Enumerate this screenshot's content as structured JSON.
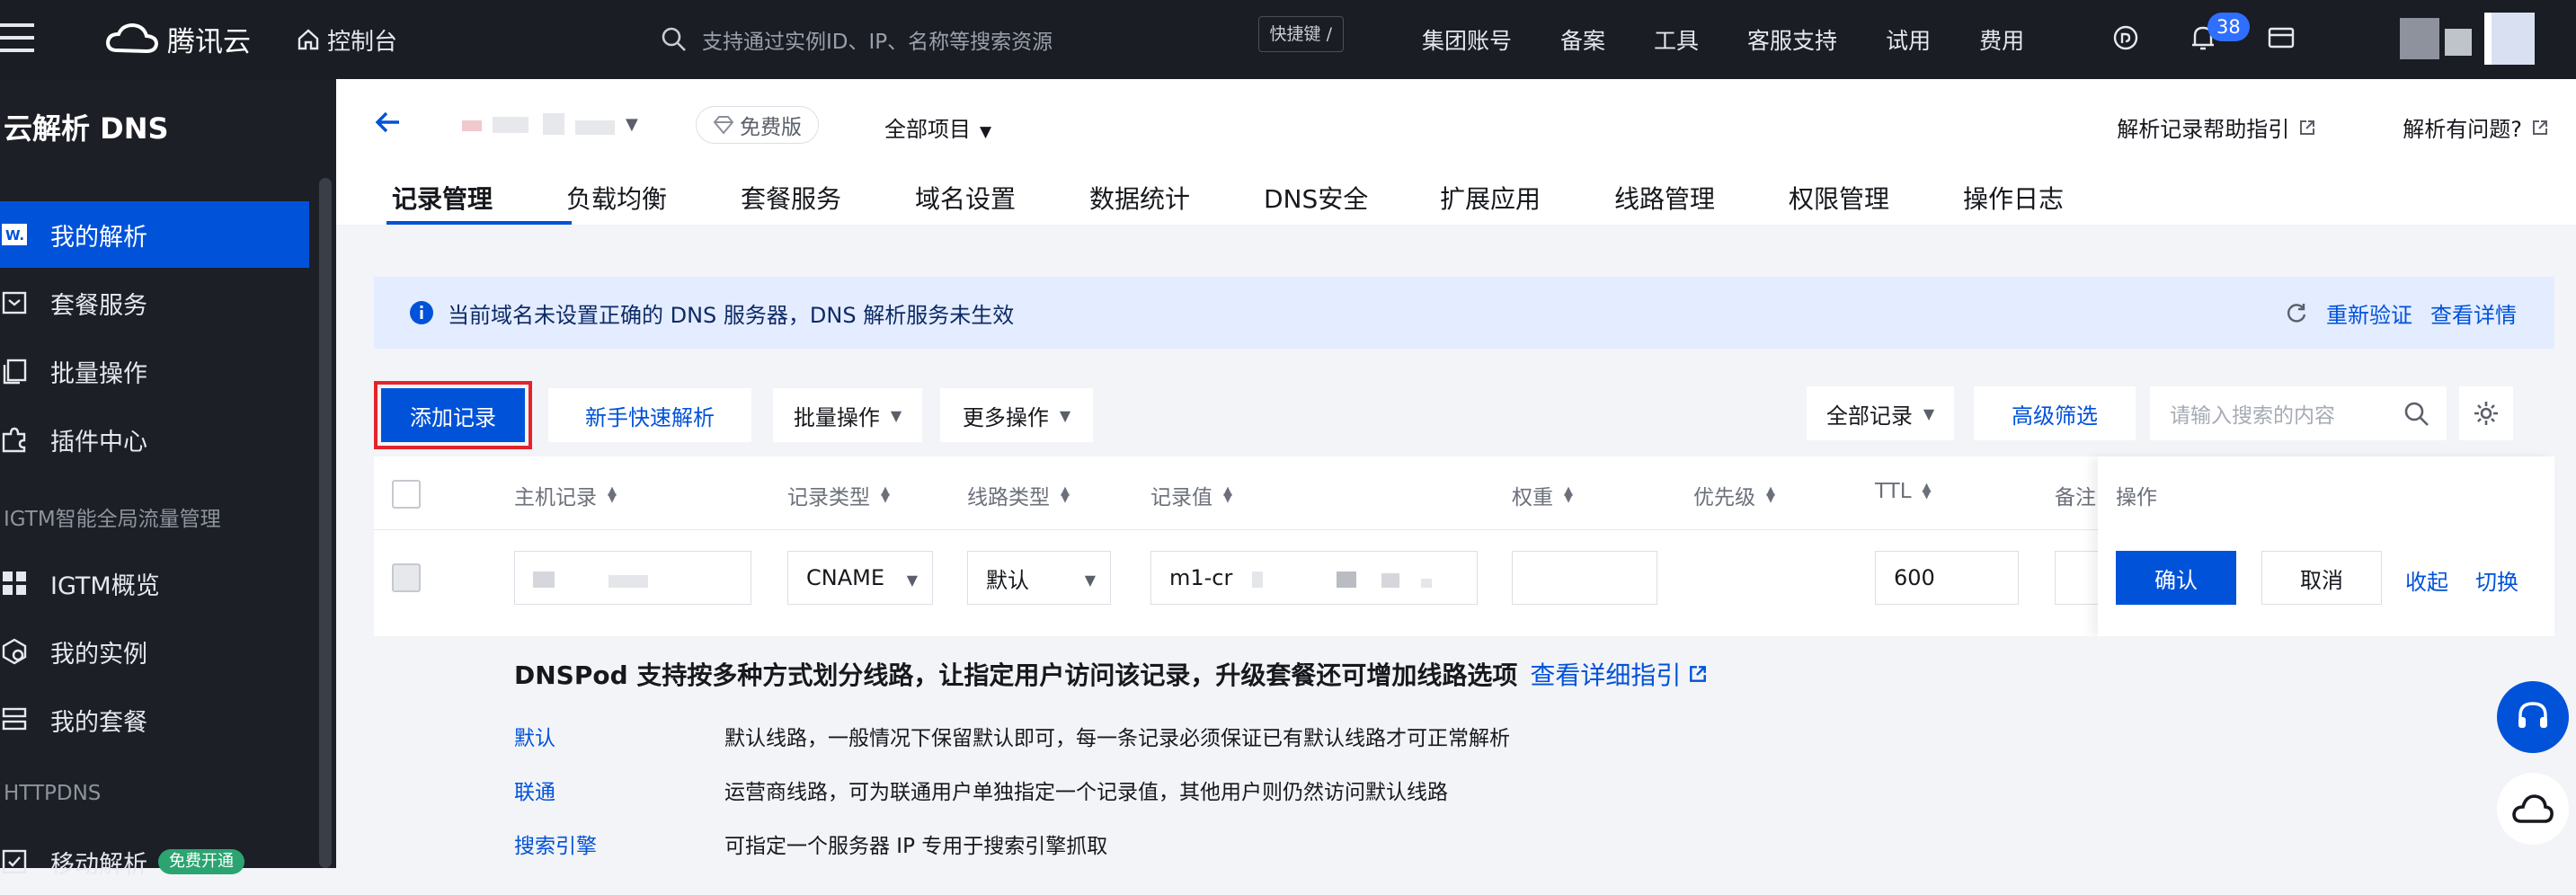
{
  "topbar": {
    "logo_text": "腾讯云",
    "console_label": "控制台",
    "search_placeholder": "支持通过实例ID、IP、名称等搜索资源",
    "shortcut_label": "快捷键 /",
    "nav": [
      "集团账号",
      "备案",
      "工具",
      "客服支持",
      "试用",
      "费用"
    ],
    "notification_count": "38"
  },
  "sidebar": {
    "title": "云解析 DNS",
    "items": [
      {
        "label": "我的解析",
        "icon": "dns-icon",
        "active": true
      },
      {
        "label": "套餐服务",
        "icon": "package-icon"
      },
      {
        "label": "批量操作",
        "icon": "batch-icon"
      },
      {
        "label": "插件中心",
        "icon": "plugin-icon"
      }
    ],
    "group_igtm": "IGTM智能全局流量管理",
    "igtm_items": [
      {
        "label": "IGTM概览",
        "icon": "grid-icon"
      },
      {
        "label": "我的实例",
        "icon": "instance-icon"
      },
      {
        "label": "我的套餐",
        "icon": "list-icon"
      }
    ],
    "group_httpdns": "HTTPDNS",
    "httpdns_item": "移动解析",
    "httpdns_badge": "免费开通"
  },
  "header": {
    "plan_badge": "免费版",
    "project_select": "全部项目",
    "help_link": "解析记录帮助指引",
    "problem_link": "解析有问题?",
    "tabs": [
      "记录管理",
      "负载均衡",
      "套餐服务",
      "域名设置",
      "数据统计",
      "DNS安全",
      "扩展应用",
      "线路管理",
      "权限管理",
      "操作日志"
    ]
  },
  "alert": {
    "message": "当前域名未设置正确的 DNS 服务器，DNS 解析服务未生效",
    "reverify": "重新验证",
    "detail": "查看详情"
  },
  "toolbar": {
    "add_record": "添加记录",
    "quick_resolve": "新手快速解析",
    "batch_ops": "批量操作",
    "more_ops": "更多操作",
    "all_records": "全部记录",
    "advanced_filter": "高级筛选",
    "search_placeholder": "请输入搜索的内容"
  },
  "table": {
    "columns": [
      "主机记录",
      "记录类型",
      "线路类型",
      "记录值",
      "权重",
      "优先级",
      "TTL",
      "备注",
      "操作"
    ],
    "edit_row": {
      "host": "",
      "type": "CNAME",
      "line": "默认",
      "value": "m1-cr",
      "weight": "",
      "ttl": "600"
    },
    "actions": {
      "confirm": "确认",
      "cancel": "取消",
      "collapse": "收起",
      "switch": "切换"
    }
  },
  "tips": {
    "heading": "DNSPod 支持按多种方式划分线路，让指定用户访问该记录，升级套餐还可增加线路选项",
    "heading_link": "查看详细指引",
    "lines": [
      {
        "key": "默认",
        "desc": "默认线路，一般情况下保留默认即可，每一条记录必须保证已有默认线路才可正常解析"
      },
      {
        "key": "联通",
        "desc": "运营商线路，可为联通用户单独指定一个记录值，其他用户则仍然访问默认线路"
      },
      {
        "key": "搜索引擎",
        "desc": "可指定一个服务器 IP 专用于搜索引擎抓取"
      }
    ]
  },
  "colors": {
    "brand": "#0052d9",
    "alert_bg": "#e4ecff",
    "sidebar_bg": "#1c1f26",
    "highlight_box": "#e3242b"
  }
}
